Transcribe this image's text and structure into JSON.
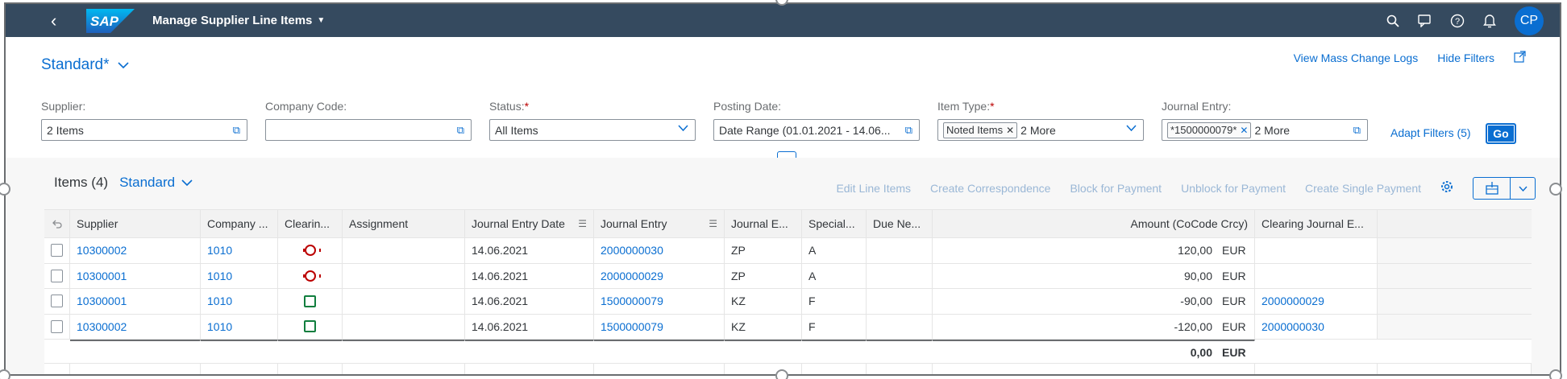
{
  "shell": {
    "back_icon": "back-arrow-icon",
    "logo_text": "SAP",
    "app_title": "Manage Supplier Line Items",
    "icons": [
      "search-icon",
      "feedback-icon",
      "help-icon",
      "notification-icon"
    ],
    "avatar": "CP",
    "colors": {
      "shell_bg": "#354a5f",
      "accent": "#0a6ed1"
    }
  },
  "header": {
    "variant": "Standard*",
    "links": {
      "mass_change": "View Mass Change Logs",
      "hide_filters": "Hide Filters"
    },
    "filters": {
      "supplier": {
        "label": "Supplier:",
        "value": "2 Items"
      },
      "company_code": {
        "label": "Company Code:",
        "value": ""
      },
      "status": {
        "label": "Status:",
        "required": "*",
        "value": "All Items"
      },
      "posting_date": {
        "label": "Posting Date:",
        "value": "Date Range (01.01.2021 - 14.06..."
      },
      "item_type": {
        "label": "Item Type:",
        "required": "*",
        "token": "Noted Items",
        "more": "2 More"
      },
      "journal_entry": {
        "label": "Journal Entry:",
        "token": "*1500000079*",
        "more": "2 More"
      }
    },
    "adapt_filters": "Adapt Filters (5)",
    "go": "Go"
  },
  "table": {
    "title": "Items (4)",
    "variant": "Standard",
    "actions": [
      "Edit Line Items",
      "Create Correspondence",
      "Block for Payment",
      "Unblock for Payment",
      "Create Single Payment"
    ],
    "columns": {
      "supplier": "Supplier",
      "company": "Company ...",
      "clearing": "Clearin...",
      "assignment": "Assignment",
      "je_date": "Journal Entry Date",
      "journal_entry": "Journal Entry",
      "je_type": "Journal E...",
      "special": "Special...",
      "due": "Due Ne...",
      "amount": "Amount (CoCode Crcy)",
      "clearing_je": "Clearing Journal E..."
    },
    "rows": [
      {
        "supplier": "10300002",
        "company": "1010",
        "status": "open",
        "je_date": "14.06.2021",
        "journal_entry": "2000000030",
        "je_type": "ZP",
        "special": "A",
        "amount": "120,00",
        "currency": "EUR",
        "clearing_je": ""
      },
      {
        "supplier": "10300001",
        "company": "1010",
        "status": "open",
        "je_date": "14.06.2021",
        "journal_entry": "2000000029",
        "je_type": "ZP",
        "special": "A",
        "amount": "90,00",
        "currency": "EUR",
        "clearing_je": ""
      },
      {
        "supplier": "10300001",
        "company": "1010",
        "status": "cleared",
        "je_date": "14.06.2021",
        "journal_entry": "1500000079",
        "je_type": "KZ",
        "special": "F",
        "amount": "-90,00",
        "currency": "EUR",
        "clearing_je": "2000000029"
      },
      {
        "supplier": "10300002",
        "company": "1010",
        "status": "cleared",
        "je_date": "14.06.2021",
        "journal_entry": "1500000079",
        "je_type": "KZ",
        "special": "F",
        "amount": "-120,00",
        "currency": "EUR",
        "clearing_je": "2000000030"
      }
    ],
    "total": {
      "amount": "0,00",
      "currency": "EUR"
    },
    "status_colors": {
      "open": "#bb0000",
      "cleared": "#107e3e"
    }
  }
}
